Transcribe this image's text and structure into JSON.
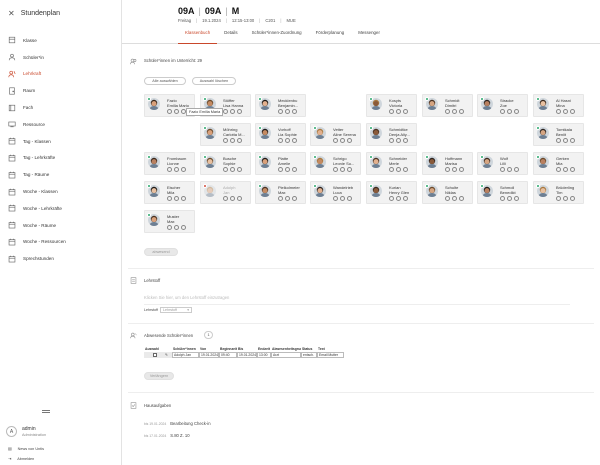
{
  "app": {
    "title": "Stundenplan"
  },
  "sidebar": {
    "items": [
      {
        "label": "Klasse",
        "icon": "class-icon",
        "active": false
      },
      {
        "label": "Schüler*in",
        "icon": "student-icon",
        "active": false
      },
      {
        "label": "Lehrkraft",
        "icon": "teacher-icon",
        "active": true
      },
      {
        "label": "Raum",
        "icon": "room-icon",
        "active": false
      },
      {
        "label": "Fach",
        "icon": "subject-icon",
        "active": false
      },
      {
        "label": "Ressource",
        "icon": "resource-icon",
        "active": false
      },
      {
        "label": "Tag - Klassen",
        "icon": "calendar-icon",
        "active": false
      },
      {
        "label": "Tag - Lehrkräfte",
        "icon": "calendar-icon",
        "active": false
      },
      {
        "label": "Tag - Räume",
        "icon": "calendar-icon",
        "active": false
      },
      {
        "label": "Woche - Klassen",
        "icon": "calendar-icon",
        "active": false
      },
      {
        "label": "Woche - Lehrkräfte",
        "icon": "calendar-icon",
        "active": false
      },
      {
        "label": "Woche - Räume",
        "icon": "calendar-icon",
        "active": false
      },
      {
        "label": "Woche - Ressourcen",
        "icon": "calendar-icon",
        "active": false
      },
      {
        "label": "Sprechstunden",
        "icon": "calendar-icon",
        "active": false
      }
    ],
    "user": {
      "initial": "A",
      "name": "admin",
      "role": "Administration"
    },
    "news_label": "News von Untis",
    "logout_label": "Abmelden"
  },
  "header": {
    "class1": "09A",
    "class2": "09A",
    "teacher": "M",
    "day": "Freitag",
    "date": "19.1.2024",
    "time": "12:15-13:00",
    "room": "C201",
    "subject": "MUE",
    "tabs": [
      "Klassenbuch",
      "Details",
      "Schüler*innen-Zuordnung",
      "Förderplanung",
      "Messenger"
    ],
    "active_tab": 0
  },
  "students_section": {
    "label": "Schüler*innen im Unterricht",
    "count": "29",
    "select_all": "Alle auswählen",
    "deselect": "Auswahl löschen",
    "tooltip": "Fazio Emilia Maria",
    "absent_button": "abwesend"
  },
  "students": [
    {
      "first": "Fazio",
      "last": "Emilia Mario",
      "status": "present"
    },
    {
      "first": "Stöffer",
      "last": "Lisa Hanna",
      "status": "present"
    },
    {
      "first": "Mecklenbu",
      "last": "Benjamin...",
      "status": "present"
    },
    {
      "first": "Kosyts",
      "last": "Victoria",
      "status": "present"
    },
    {
      "first": "Schmidt",
      "last": "Dimitri",
      "status": "present"
    },
    {
      "first": "Stracke",
      "last": "Zoe",
      "status": "present"
    },
    {
      "first": "Al Hasni",
      "last": "Mina",
      "status": "present"
    },
    {
      "first": "Möhring",
      "last": "Carlotta M...",
      "status": "present"
    },
    {
      "first": "Vorhoff",
      "last": "Lia Sophie",
      "status": "present"
    },
    {
      "first": "Vetter",
      "last": "Aline Serena",
      "status": "present"
    },
    {
      "first": "Schmidtke",
      "last": "Denja Aliy...",
      "status": "present"
    },
    {
      "first": "Tomtkala",
      "last": "Beniit",
      "status": "present"
    },
    {
      "first": "Frombaum",
      "last": "Lionne",
      "status": "present"
    },
    {
      "first": "Busche",
      "last": "Sophie",
      "status": "present"
    },
    {
      "first": "Platte",
      "last": "Amelie",
      "status": "present"
    },
    {
      "first": "Schrigo",
      "last": "Leonie Su...",
      "status": "present"
    },
    {
      "first": "Schneider",
      "last": "Merle",
      "status": "present"
    },
    {
      "first": "Hoffmann",
      "last": "Marisa",
      "status": "present"
    },
    {
      "first": "Wolf",
      "last": "Lilli",
      "status": "present"
    },
    {
      "first": "Gerken",
      "last": "Mia",
      "status": "present"
    },
    {
      "first": "Eischer",
      "last": "Mila",
      "status": "present"
    },
    {
      "first": "Adolph",
      "last": "Jan",
      "status": "absent"
    },
    {
      "first": "Pielkolmeier",
      "last": "Max",
      "status": "present"
    },
    {
      "first": "Wandelrieb",
      "last": "Luca",
      "status": "present"
    },
    {
      "first": "Kurian",
      "last": "Henry Glen",
      "status": "present"
    },
    {
      "first": "Schulte",
      "last": "Niklas",
      "status": "present"
    },
    {
      "first": "Schmoll",
      "last": "Benedikt",
      "status": "present"
    },
    {
      "first": "Brüderling",
      "last": "Tim",
      "status": "present"
    },
    {
      "first": "Muster",
      "last": "Max",
      "status": "present"
    }
  ],
  "lesson": {
    "label": "Lehrstoff",
    "placeholder": "Klicken Sie hier, um den Lehrstoff einzutragen",
    "field_label": "Lehrstoff",
    "select_placeholder": "Lehrstoff"
  },
  "absent_section": {
    "label": "Abwesende Schüler*innen",
    "count": "1",
    "columns": [
      "Auswahl",
      "",
      "Schüler*innen",
      "Von",
      "Beginnzeit",
      "Bis",
      "Endzeit",
      "Abwesenheitsgrund",
      "Status",
      "Text"
    ],
    "rows": [
      {
        "student": "Adolph Jan",
        "from": "19.01.2024",
        "start": "09:40",
        "to": "19.01.2024",
        "end": "13:00",
        "reason": "Arzt",
        "status": "entsch.",
        "text": "Email Mutter"
      }
    ],
    "button": "Verlängern"
  },
  "homework": {
    "label": "Hausaufgaben",
    "entries": [
      {
        "date": "bis 19.01.2024",
        "text": "Bearbeitung Check-in"
      },
      {
        "date": "bis 17.01.2024",
        "text": "S.80 Z. 10"
      }
    ]
  },
  "colors": {
    "accent": "#c9482b",
    "present": "#2aa76b",
    "absent": "#d24b3a"
  }
}
